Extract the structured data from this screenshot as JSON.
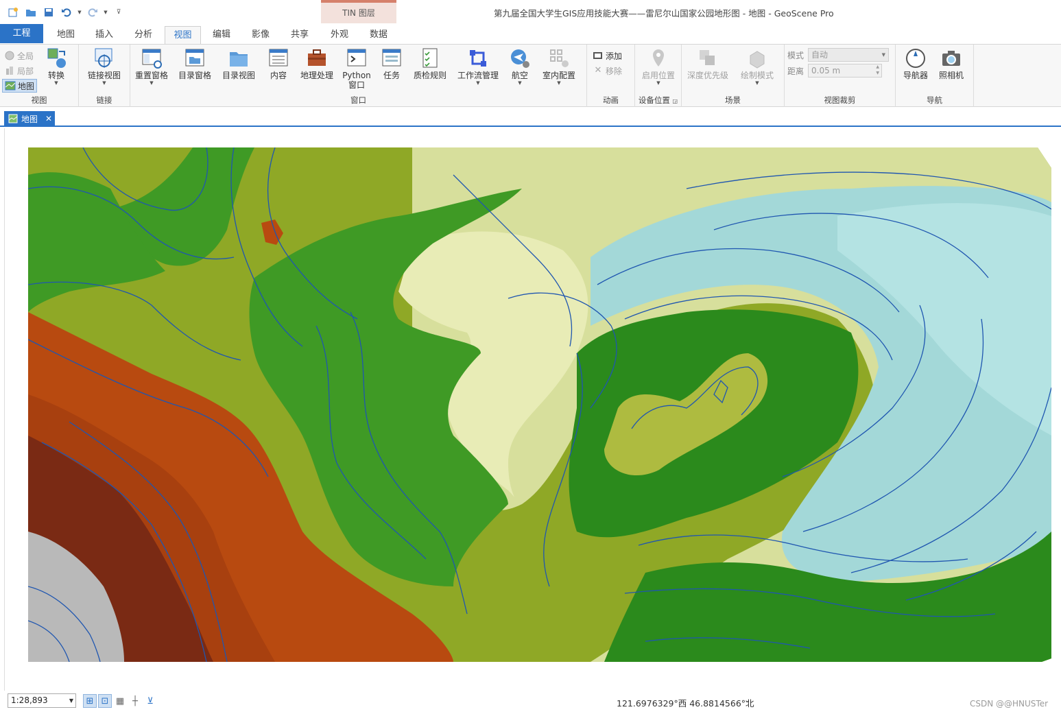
{
  "window": {
    "title": "第九届全国大学生GIS应用技能大赛——雷尼尔山国家公园地形图 - 地图 - GeoScene Pro"
  },
  "context_group": {
    "label": "TIN 图层"
  },
  "tabs": [
    "工程",
    "地图",
    "插入",
    "分析",
    "视图",
    "编辑",
    "影像",
    "共享",
    "外观",
    "数据"
  ],
  "active_tab": "视图",
  "ribbon": {
    "view_group": {
      "label": "视图",
      "full": "全局",
      "local": "局部",
      "map": "地图",
      "convert": "转换"
    },
    "link_group": {
      "label": "链接",
      "link_views": "链接视图"
    },
    "window_group": {
      "label": "窗口",
      "reset_panes": "重置窗格",
      "catalog_pane": "目录窗格",
      "catalog_view": "目录视图",
      "contents": "内容",
      "geoprocessing": "地理处理",
      "python_line1": "Python",
      "python_line2": "窗口",
      "tasks": "任务",
      "quality_rules": "质检规则",
      "workflow": "工作流管理",
      "aviation": "航空",
      "indoor": "室内配置"
    },
    "animation_group": {
      "label": "动画",
      "add": "添加",
      "remove": "移除"
    },
    "device_group": {
      "label": "设备位置",
      "enable": "启用位置"
    },
    "scene_group": {
      "label": "场景",
      "depth_priority": "深度优先级",
      "draw_mode": "绘制模式"
    },
    "clip_group": {
      "label": "视图裁剪",
      "mode_label": "模式",
      "mode_value": "自动",
      "distance_label": "距离",
      "distance_value": "0.05 m"
    },
    "nav_group": {
      "label": "导航",
      "navigator": "导航器",
      "camera": "照相机"
    }
  },
  "doc_tab": {
    "label": "地图"
  },
  "status": {
    "scale": "1:28,893",
    "coordinates": "121.6976329°西 46.8814566°北",
    "watermark": "CSDN @@HNUSTer"
  },
  "map_colors": {
    "gray_peak": "#b9b9b9",
    "brown_dark": "#7a2a14",
    "brown": "#a8400f",
    "orange_red": "#b84a10",
    "olive": "#8fa826",
    "olive_light": "#aebb40",
    "green": "#3f9a25",
    "green_dark": "#2b8a1c",
    "pale": "#d7df9c",
    "cream": "#e8ecb6",
    "cyan": "#a3d8d8",
    "cyan_light": "#b4e3e3",
    "contour": "#1f56b0"
  }
}
